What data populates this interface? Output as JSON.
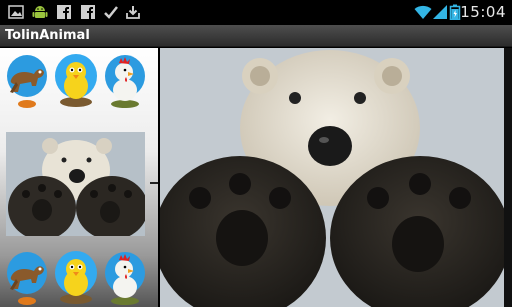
{
  "status_bar": {
    "time": "15:04",
    "left_icons": [
      "image-icon",
      "android-icon",
      "facebook-icon",
      "facebook-icon",
      "check-icon",
      "download-icon"
    ],
    "right_icons": [
      "wifi-icon",
      "signal-icon",
      "battery-icon"
    ],
    "battery_color": "#33b5e5"
  },
  "app": {
    "title": "TolinAnimal"
  },
  "gallery": {
    "thumbnails": [
      "horse-icon",
      "chick-icon",
      "chicken-icon",
      "horse-icon",
      "chick-icon",
      "chicken-icon"
    ],
    "selected_image": "polar-bear-photo"
  }
}
